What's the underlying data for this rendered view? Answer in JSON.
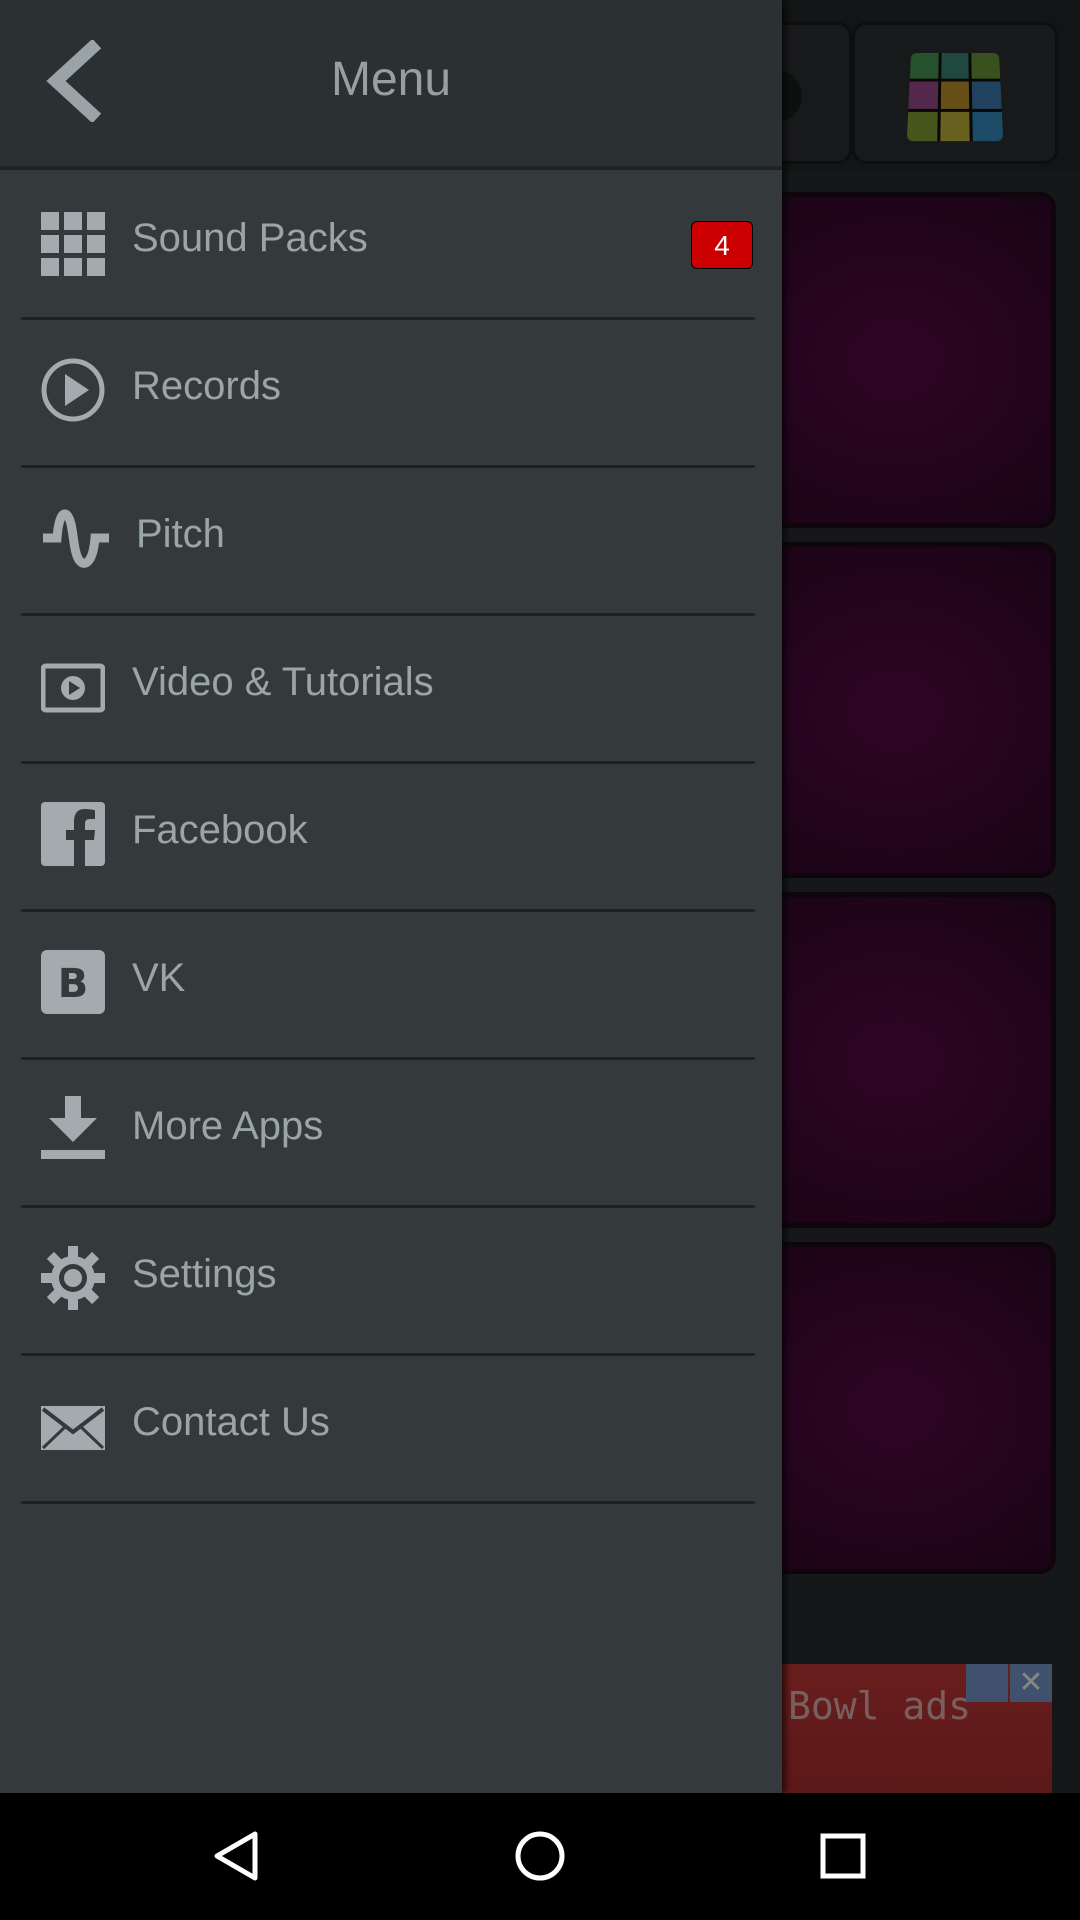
{
  "header": {
    "title": "Menu"
  },
  "menu": {
    "items": [
      {
        "label": "Sound Packs",
        "icon": "grid-icon",
        "badge": "4"
      },
      {
        "label": "Records",
        "icon": "play-circle-icon"
      },
      {
        "label": "Pitch",
        "icon": "pitch-wave-icon"
      },
      {
        "label": "Video & Tutorials",
        "icon": "video-play-icon"
      },
      {
        "label": "Facebook",
        "icon": "facebook-icon"
      },
      {
        "label": "VK",
        "icon": "vk-icon"
      },
      {
        "label": "More Apps",
        "icon": "download-icon"
      },
      {
        "label": "Settings",
        "icon": "gear-icon"
      },
      {
        "label": "Contact Us",
        "icon": "envelope-icon"
      }
    ]
  },
  "ad": {
    "text": "Bowl ads"
  },
  "colors": {
    "drawer_background": "#343a3b",
    "header_background": "#2b3032",
    "text": "#9aa5a8",
    "badge": "#cc0000",
    "pad": "#47093a",
    "ad_banner": "#b12f30"
  },
  "navbar": {
    "back": "nav-back-icon",
    "home": "nav-home-icon",
    "recents": "nav-recents-icon"
  }
}
